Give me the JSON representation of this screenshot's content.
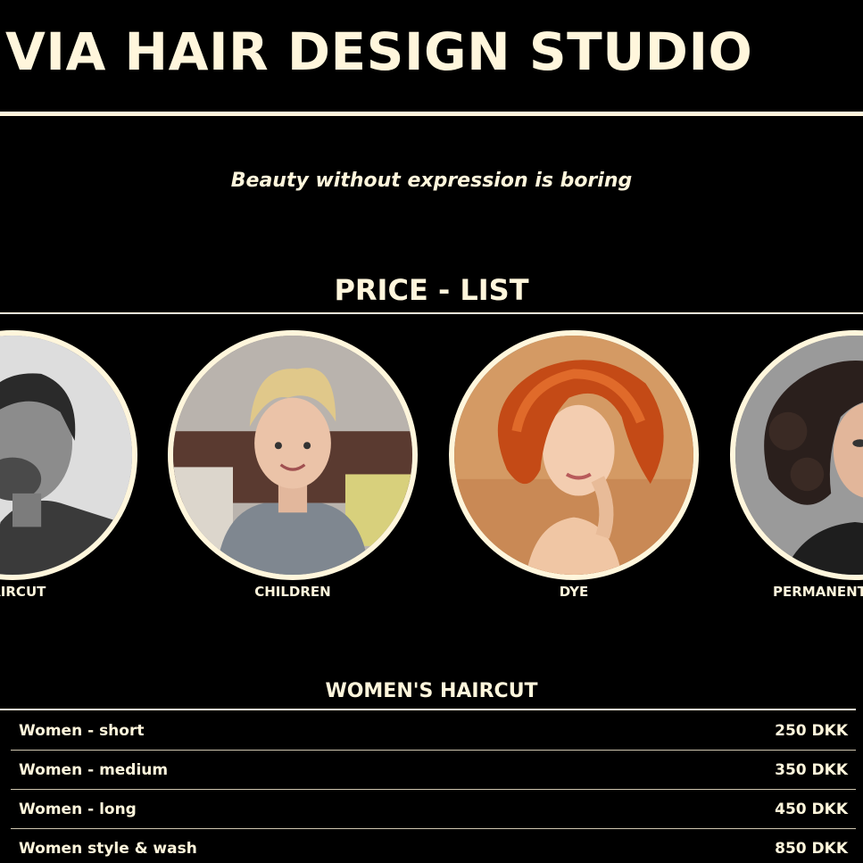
{
  "header": {
    "title": "VIA HAIR DESIGN STUDIO",
    "tagline": "Beauty without expression is boring"
  },
  "price_list": {
    "title": "PRICE - LIST",
    "categories": [
      {
        "label": "HAIRCUT",
        "image": "man-haircut-photo"
      },
      {
        "label": "CHILDREN",
        "image": "child-haircut-photo"
      },
      {
        "label": "DYE",
        "image": "red-hair-dye-photo"
      },
      {
        "label": "PERMANENT",
        "image": "curly-permanent-photo"
      }
    ]
  },
  "womens_haircut": {
    "title": "WOMEN'S HAIRCUT",
    "rows": [
      {
        "name": "Women - short",
        "price": "250 DKK"
      },
      {
        "name": "Women - medium",
        "price": "350 DKK"
      },
      {
        "name": "Women - long",
        "price": "450 DKK"
      },
      {
        "name": "Women style & wash",
        "price": "850 DKK"
      }
    ]
  },
  "colors": {
    "background": "#000000",
    "accent": "#fff6dc"
  }
}
